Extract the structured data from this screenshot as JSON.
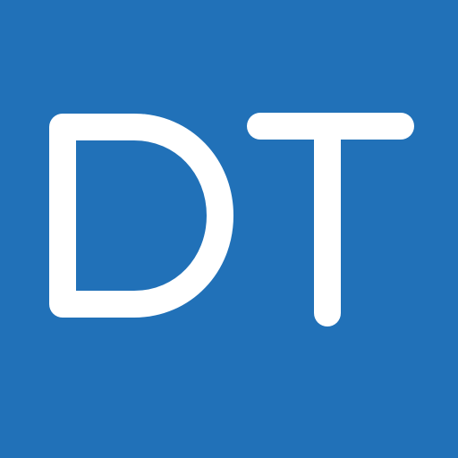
{
  "icon": {
    "name": "dt-logo-icon",
    "lettering": "DT",
    "colors": {
      "background": "#2171B8",
      "foreground": "#FFFFFF"
    }
  }
}
